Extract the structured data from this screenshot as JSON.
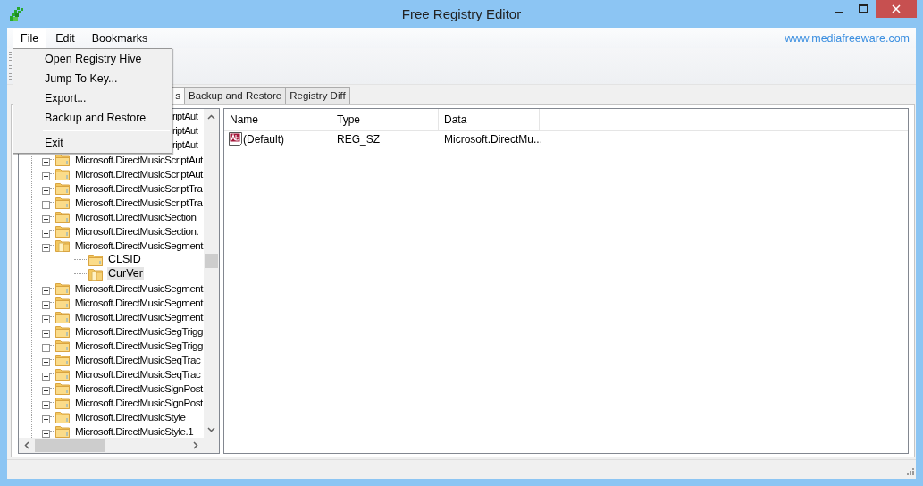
{
  "window": {
    "title": "Free Registry Editor"
  },
  "menu": [
    {
      "label": "File",
      "selected": true
    },
    {
      "label": "Edit",
      "selected": false
    },
    {
      "label": "Bookmarks",
      "selected": false
    }
  ],
  "website_link": "www.mediafreeware.com",
  "file_menu": [
    {
      "kind": "item",
      "label": "Open Registry Hive"
    },
    {
      "kind": "item",
      "label": "Jump To Key..."
    },
    {
      "kind": "item",
      "label": "Export..."
    },
    {
      "kind": "item",
      "label": "Backup and Restore"
    },
    {
      "kind": "separator"
    },
    {
      "kind": "item",
      "label": "Exit"
    }
  ],
  "tabs": [
    {
      "label": "s",
      "selected": true,
      "partial": true
    },
    {
      "label": "Backup and Restore",
      "selected": false,
      "partial": false
    },
    {
      "label": "Registry Diff",
      "selected": false,
      "partial": false
    }
  ],
  "tree": [
    {
      "label": "riptAut",
      "partial": true,
      "selected": false
    },
    {
      "label": "riptAut",
      "partial": true,
      "selected": false
    },
    {
      "label": "riptAut",
      "partial": true,
      "selected": false
    },
    {
      "label": "Microsoft.DirectMusicScriptAut",
      "partial": false,
      "expanded": false,
      "selected": false
    },
    {
      "label": "Microsoft.DirectMusicScriptAut",
      "partial": false,
      "expanded": false,
      "selected": false
    },
    {
      "label": "Microsoft.DirectMusicScriptTra",
      "partial": false,
      "expanded": false,
      "selected": false
    },
    {
      "label": "Microsoft.DirectMusicScriptTra",
      "partial": false,
      "expanded": false,
      "selected": false
    },
    {
      "label": "Microsoft.DirectMusicSection",
      "partial": false,
      "expanded": false,
      "selected": false
    },
    {
      "label": "Microsoft.DirectMusicSection.",
      "partial": false,
      "expanded": false,
      "selected": false
    },
    {
      "label": "Microsoft.DirectMusicSegment",
      "partial": false,
      "expanded": true,
      "selected": false,
      "children": [
        {
          "label": "CLSID",
          "selected": false
        },
        {
          "label": "CurVer",
          "selected": true
        }
      ]
    },
    {
      "label": "Microsoft.DirectMusicSegment",
      "partial": false,
      "expanded": false,
      "selected": false
    },
    {
      "label": "Microsoft.DirectMusicSegment",
      "partial": false,
      "expanded": false,
      "selected": false
    },
    {
      "label": "Microsoft.DirectMusicSegment",
      "partial": false,
      "expanded": false,
      "selected": false
    },
    {
      "label": "Microsoft.DirectMusicSegTrigg",
      "partial": false,
      "expanded": false,
      "selected": false
    },
    {
      "label": "Microsoft.DirectMusicSegTrigg",
      "partial": false,
      "expanded": false,
      "selected": false
    },
    {
      "label": "Microsoft.DirectMusicSeqTrac",
      "partial": false,
      "expanded": false,
      "selected": false
    },
    {
      "label": "Microsoft.DirectMusicSeqTrac",
      "partial": false,
      "expanded": false,
      "selected": false
    },
    {
      "label": "Microsoft.DirectMusicSignPost",
      "partial": false,
      "expanded": false,
      "selected": false
    },
    {
      "label": "Microsoft.DirectMusicSignPost",
      "partial": false,
      "expanded": false,
      "selected": false
    },
    {
      "label": "Microsoft.DirectMusicStyle",
      "partial": false,
      "expanded": false,
      "selected": false
    },
    {
      "label": "Microsoft.DirectMusicStyle.1",
      "partial": false,
      "expanded": false,
      "selected": false
    }
  ],
  "values": {
    "columns": [
      "Name",
      "Type",
      "Data"
    ],
    "rows": [
      {
        "name": "(Default)",
        "type": "REG_SZ",
        "data": "Microsoft.DirectMu..."
      }
    ]
  }
}
